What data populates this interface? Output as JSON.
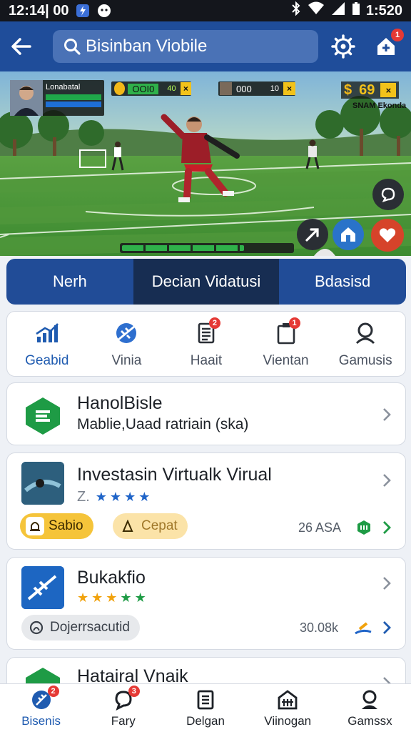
{
  "status_bar": {
    "time": "12:14| 00",
    "clock": "1:520"
  },
  "app_bar": {
    "search_text": "Bisinban Viobile",
    "notification_count": "1"
  },
  "game_hud": {
    "player_label": "Lonabatal",
    "mid_score_left": "OOI0",
    "mid_score_mark": "40",
    "mid_score_right": "000",
    "mid_score_right_count": "10",
    "coins": "69",
    "coin_sub": "SNAM Ekonda",
    "progress": 0.72
  },
  "tabs": [
    {
      "label": "Nerh",
      "active": false
    },
    {
      "label": "Decian Vidatusi",
      "active": true
    },
    {
      "label": "Bdasisd",
      "active": false
    }
  ],
  "quick_actions": [
    {
      "label": "Geabid",
      "icon": "chart-icon",
      "badge": ""
    },
    {
      "label": "Vinia",
      "icon": "satellite-icon",
      "badge": ""
    },
    {
      "label": "Haait",
      "icon": "document-icon",
      "badge": "2"
    },
    {
      "label": "Vientan",
      "icon": "clipboard-icon",
      "badge": "1"
    },
    {
      "label": "Gamusis",
      "icon": "profile-icon",
      "badge": ""
    }
  ],
  "cards": [
    {
      "title": "HanolBisle",
      "subtitle": "Mablie,Uaad ratriain (skа)"
    },
    {
      "title": "Investasin Virtualk Virual",
      "rating_prefix": "Z.",
      "rating": 4,
      "pill_one": "Sabio",
      "pill_two": "Cepat",
      "meta": "26 ASA"
    },
    {
      "title": "Bukakfio",
      "rating": 5,
      "pill_one": "Dojerrsacutid",
      "meta": "30.08k"
    },
    {
      "title": "Hatairal Vnaik"
    }
  ],
  "bottom_nav": [
    {
      "label": "Bisenis",
      "badge": "2",
      "active": true
    },
    {
      "label": "Fary",
      "badge": "3",
      "active": false
    },
    {
      "label": "Delgan",
      "badge": "",
      "active": false
    },
    {
      "label": "Viinogan",
      "badge": "",
      "active": false
    },
    {
      "label": "Gamssx",
      "badge": "",
      "active": false
    }
  ],
  "colors": {
    "brand_blue": "#1f4d9a",
    "tab_active": "#172d52",
    "accent_green": "#1e9b45",
    "star_blue": "#1f64c8",
    "star_orange": "#f1a20c",
    "badge_red": "#e53935"
  }
}
